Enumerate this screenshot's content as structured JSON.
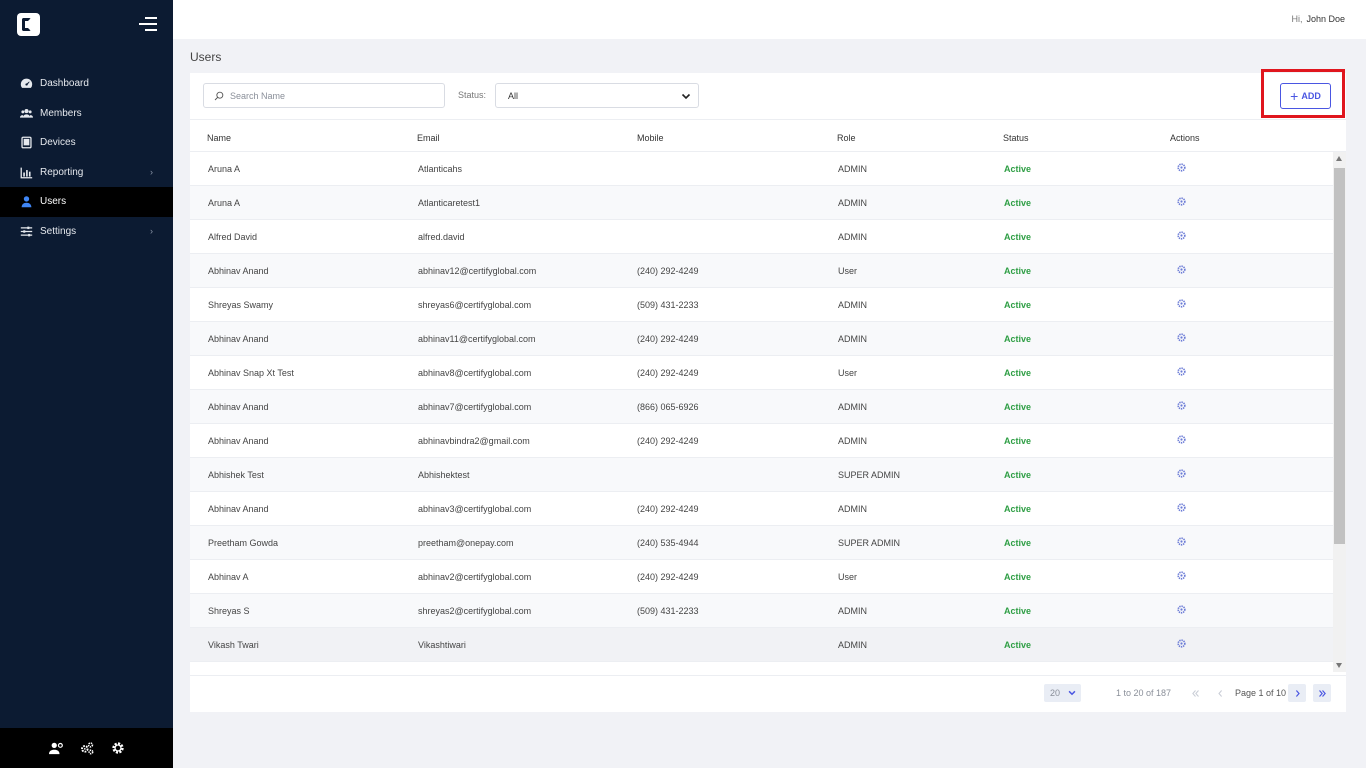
{
  "sidebar": {
    "items": [
      {
        "label": "Dashboard",
        "icon": "dashboard-icon"
      },
      {
        "label": "Members",
        "icon": "members-icon"
      },
      {
        "label": "Devices",
        "icon": "devices-icon"
      },
      {
        "label": "Reporting",
        "icon": "reporting-icon"
      },
      {
        "label": "Users",
        "icon": "user-icon"
      },
      {
        "label": "Settings",
        "icon": "settings-icon"
      }
    ],
    "active": "Users"
  },
  "header": {
    "hi": "Hi,",
    "user": "John Doe"
  },
  "page": {
    "title": "Users"
  },
  "filters": {
    "search_placeholder": "Search Name",
    "status_label": "Status:",
    "status_value": "All"
  },
  "toolbar": {
    "add_label": "ADD"
  },
  "table": {
    "columns": [
      "Name",
      "Email",
      "Mobile",
      "Role",
      "Status",
      "Actions"
    ],
    "rows": [
      {
        "name": "Aruna A",
        "email": "Atlanticahs",
        "mobile": "",
        "role": "ADMIN",
        "status": "Active"
      },
      {
        "name": "Aruna A",
        "email": "Atlanticaretest1",
        "mobile": "",
        "role": "ADMIN",
        "status": "Active"
      },
      {
        "name": "Alfred David",
        "email": "alfred.david",
        "mobile": "",
        "role": "ADMIN",
        "status": "Active"
      },
      {
        "name": "Abhinav Anand",
        "email": "abhinav12@certifyglobal.com",
        "mobile": "(240) 292-4249",
        "role": "User",
        "status": "Active"
      },
      {
        "name": "Shreyas Swamy",
        "email": "shreyas6@certifyglobal.com",
        "mobile": "(509) 431-2233",
        "role": "ADMIN",
        "status": "Active"
      },
      {
        "name": "Abhinav Anand",
        "email": "abhinav11@certifyglobal.com",
        "mobile": "(240) 292-4249",
        "role": "ADMIN",
        "status": "Active"
      },
      {
        "name": "Abhinav Snap Xt Test",
        "email": "abhinav8@certifyglobal.com",
        "mobile": "(240) 292-4249",
        "role": "User",
        "status": "Active"
      },
      {
        "name": "Abhinav Anand",
        "email": "abhinav7@certifyglobal.com",
        "mobile": "(866) 065-6926",
        "role": "ADMIN",
        "status": "Active"
      },
      {
        "name": "Abhinav Anand",
        "email": "abhinavbindra2@gmail.com",
        "mobile": "(240) 292-4249",
        "role": "ADMIN",
        "status": "Active"
      },
      {
        "name": "Abhishek Test",
        "email": "Abhishektest",
        "mobile": "",
        "role": "SUPER ADMIN",
        "status": "Active"
      },
      {
        "name": "Abhinav Anand",
        "email": "abhinav3@certifyglobal.com",
        "mobile": "(240) 292-4249",
        "role": "ADMIN",
        "status": "Active"
      },
      {
        "name": "Preetham Gowda",
        "email": "preetham@onepay.com",
        "mobile": "(240) 535-4944",
        "role": "SUPER ADMIN",
        "status": "Active"
      },
      {
        "name": "Abhinav A",
        "email": "abhinav2@certifyglobal.com",
        "mobile": "(240) 292-4249",
        "role": "User",
        "status": "Active"
      },
      {
        "name": "Shreyas S",
        "email": "shreyas2@certifyglobal.com",
        "mobile": "(509) 431-2233",
        "role": "ADMIN",
        "status": "Active"
      },
      {
        "name": "Vikash Twari",
        "email": "Vikashtiwari",
        "mobile": "",
        "role": "ADMIN",
        "status": "Active"
      }
    ]
  },
  "pagination": {
    "page_size": "20",
    "range": "1 to 20 of 187",
    "page_label": "Page 1 of 10"
  },
  "colors": {
    "sidebar": "#0c1b32",
    "accent": "#4a56e2",
    "active_status": "#2e9e44",
    "highlight": "#e0161e"
  }
}
